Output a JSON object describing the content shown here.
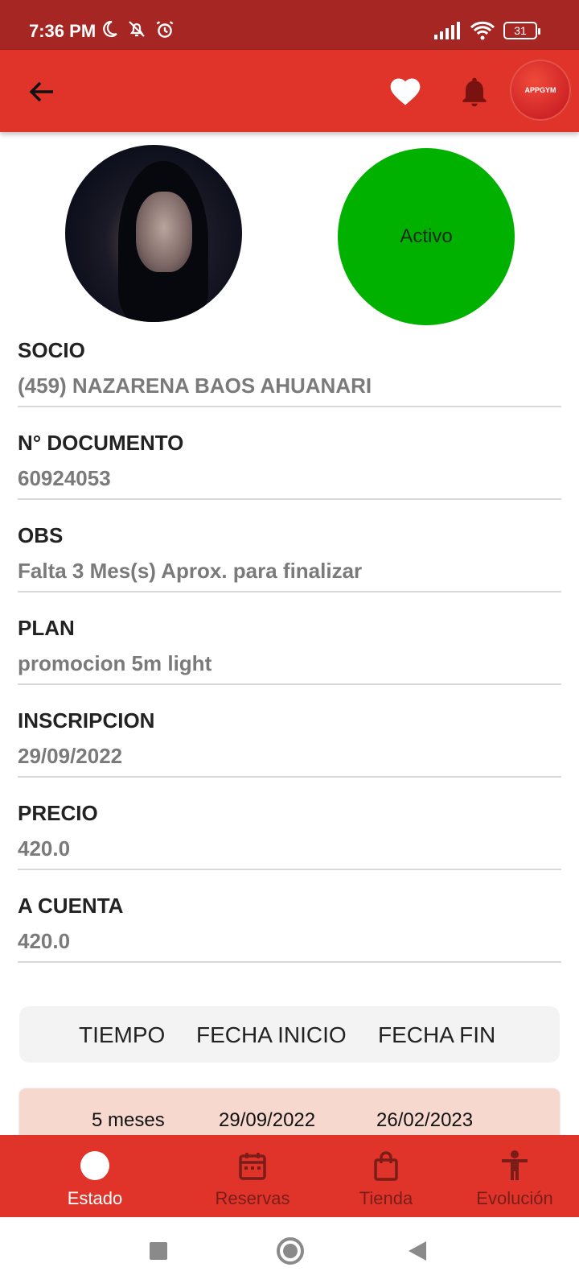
{
  "status_bar": {
    "time": "7:36 PM",
    "battery": "31",
    "icons_left": [
      "moon-icon",
      "bell-off-icon",
      "alarm-icon"
    ],
    "icons_right": [
      "signal-icon",
      "wifi-icon",
      "battery-icon"
    ]
  },
  "app_bar": {
    "icons": [
      "back-arrow-icon",
      "heart-icon",
      "bell-icon"
    ],
    "logo_text": "APPGYM"
  },
  "profile": {
    "status": "Activo",
    "status_color": "#00b100"
  },
  "fields": [
    {
      "label": "SOCIO",
      "value": "(459) NAZARENA  BAOS AHUANARI"
    },
    {
      "label": "N° DOCUMENTO",
      "value": "60924053"
    },
    {
      "label": "OBS",
      "value": "Falta 3 Mes(s) Aprox. para finalizar"
    },
    {
      "label": "PLAN",
      "value": "promocion 5m light"
    },
    {
      "label": "INSCRIPCION",
      "value": "29/09/2022"
    },
    {
      "label": "PRECIO",
      "value": "420.0"
    },
    {
      "label": "A CUENTA",
      "value": "420.0"
    }
  ],
  "table": {
    "headers": [
      "TIEMPO",
      "FECHA INICIO",
      "FECHA FIN"
    ],
    "rows": [
      [
        "5 meses",
        "29/09/2022",
        "26/02/2023"
      ]
    ]
  },
  "bottom_nav": {
    "items": [
      {
        "label": "Estado",
        "icon": "circle-icon",
        "active": true
      },
      {
        "label": "Reservas",
        "icon": "calendar-icon",
        "active": false
      },
      {
        "label": "Tienda",
        "icon": "shopping-bag-icon",
        "active": false
      },
      {
        "label": "Evolución",
        "icon": "person-icon",
        "active": false
      }
    ]
  },
  "colors": {
    "primary": "#e0342a",
    "status_bar": "#a52622",
    "active_green": "#00b100",
    "row_bg": "#f6d8cf"
  }
}
